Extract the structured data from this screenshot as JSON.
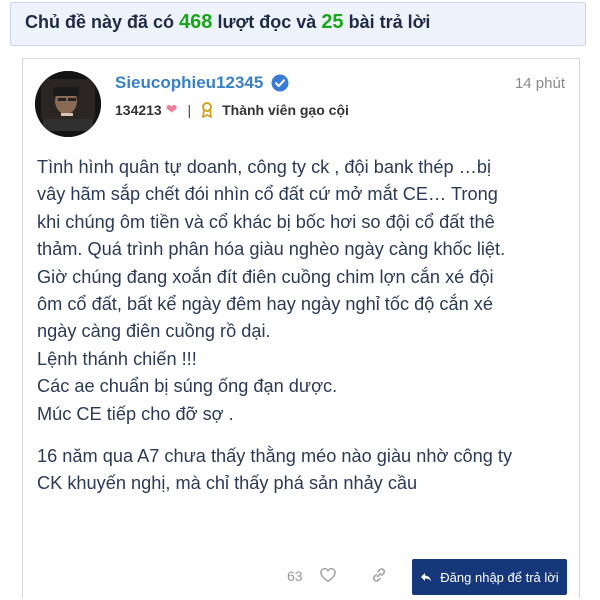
{
  "topic_stats": {
    "prefix": "Chủ đề này đã có",
    "views": "468",
    "views_suffix": "lượt đọc và",
    "replies": "25",
    "replies_suffix": "bài trả lời"
  },
  "post": {
    "username": "Sieucophieu12345",
    "time": "14 phút",
    "reputation": "134213",
    "rank": "Thành viên gạo cội",
    "body_lines": [
      "Tình hình quân tự doanh, công ty ck , đội bank thép …bị",
      "vây hãm sắp chết đói nhìn cổ đất cứ mở mắt CE… Trong",
      "khi chúng ôm tiền và cổ khác bị bốc hơi so đội cổ đất thê",
      "thảm. Quá trình phân hóa giàu nghèo ngày càng khốc liệt.",
      "Giờ chúng đang xoắn đít điên cuồng chim lợn cắn xé đội",
      "ôm cổ đất, bất kể ngày đêm hay ngày nghỉ tốc độ cắn xé",
      "ngày càng điên cuồng rồ dại.",
      "Lệnh thánh chiến !!!",
      "Các ae chuẩn bị súng ống đạn dược.",
      "Múc CE tiếp cho đỡ sợ ."
    ],
    "body_lines_2": [
      "16 năm qua A7 chưa thấy thằng méo nào giàu nhờ công ty",
      "CK khuyến nghị, mà chỉ thấy phá sản nhảy cầu"
    ],
    "likes": "63",
    "reply_label": "Đăng nhập để trả lời"
  },
  "icons": {
    "verified": "verified-badge-icon",
    "heart": "heart-icon",
    "rank": "medal-icon",
    "like": "heart-outline-icon",
    "link": "link-icon",
    "reply": "reply-arrow-icon"
  },
  "colors": {
    "username": "#3a80c4",
    "stat_numbers": "#19a519",
    "body_text": "#2b3a55",
    "reply_button": "#16387a",
    "banner_bg": "#eef3fb"
  }
}
